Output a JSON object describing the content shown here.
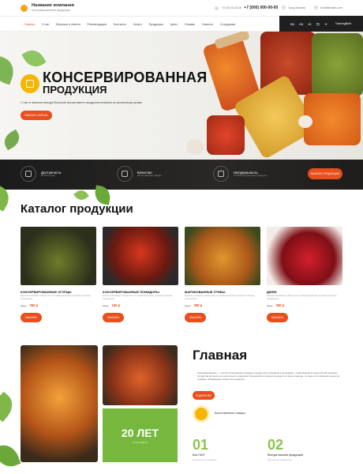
{
  "header": {
    "company_name": "Название компании",
    "company_tagline": "Консервированная продукция",
    "phone_secondary": "+ 8 (00) 00-00-00",
    "phone_primary": "+7 (000) 000-00-00",
    "city": "Город Москва",
    "email": "Email@mailto.com"
  },
  "nav": {
    "items": [
      "Главная",
      "О нас",
      "Вопросы и ответы",
      "Рекомендации",
      "Контакты",
      "Услуги",
      "Продукция",
      "Цены",
      "Отзывы",
      "Новости",
      "Сотрудники"
    ],
    "active_index": 0
  },
  "social": {
    "icons": [
      "ВК",
      "ОК",
      "Ю",
      "📷",
      "✈"
    ],
    "label": "TrainingBrief"
  },
  "hero": {
    "title_line1": "КОНСЕРВИРОВАННАЯ",
    "title_line2": "ПРОДУКЦИЯ",
    "description": "У нас в наличии всегда большой ассортимент продуктов питания по розничным ценам",
    "button_label": "ЗАКАЗАТЬ СЕЙЧАС"
  },
  "features": {
    "items": [
      {
        "title": "Доступность",
        "subtitle": "Низкие цены",
        "icon": "bag-icon"
      },
      {
        "title": "Качество",
        "subtitle": "Качественные товары",
        "icon": "pot-icon"
      },
      {
        "title": "Натуральность",
        "subtitle": "Только натуральные продукты",
        "icon": "leaf-pot-icon"
      }
    ],
    "button_label": "ВЫБРАТЬ ПРОДУКЦИЮ"
  },
  "catalog": {
    "title": "Каталог продукции",
    "products": [
      {
        "name": "КОНСЕРВИРОВАННЫЕ ОГУРЦЫ",
        "desc": "Краткое описание товара или его характеристики, которые полезны покупателю",
        "old_price": "450 р",
        "price": "350 р",
        "button": "ЗАКАЗАТЬ"
      },
      {
        "name": "КОНСЕРВИРОВАННЫЕ ПОМИДОРЫ",
        "desc": "Краткое описание товара или его характеристики, которые полезны покупателю",
        "old_price": "200 р",
        "price": "150 р",
        "button": "ЗАКАЗАТЬ"
      },
      {
        "name": "МАРИНОВАННЫЕ ГРИБЫ",
        "desc": "Краткое описание товара или его характеристики, которые полезны покупателю",
        "old_price": "400 р",
        "price": "350 р",
        "button": "ЗАКАЗАТЬ"
      },
      {
        "name": "ДЖЕМ",
        "desc": "Краткое описание товара или его характеристики, которые полезны покупателю",
        "old_price": "400 р",
        "price": "350 р",
        "button": "ЗАКАЗАТЬ"
      }
    ]
  },
  "about": {
    "title": "Главная",
    "text": "Консервирование — способ консервации пищевых продуктов (в основном в консервах), позволяющий в герметичной упаковке продуктов питания для длительного хранения. Большинство продуктов надолго в свою очередь, по мере изготовления сырья на складах, обладающих своим потенциалом.",
    "button_label": "ПОДРОБНЕЕ",
    "quality_label": "Качественные товары",
    "years_number": "20 ЛЕТ",
    "years_caption": "опыта работы",
    "stats": [
      {
        "num": "01",
        "label": "Без ГМО",
        "sub": "Натуральные продукты"
      },
      {
        "num": "02",
        "label": "Всегда свежая продукция",
        "sub": "Постоянное обновление"
      }
    ]
  },
  "colors": {
    "accent": "#e84f1d",
    "green": "#76b83d",
    "yellow": "#f7b500",
    "dark": "#1f1f1f"
  }
}
